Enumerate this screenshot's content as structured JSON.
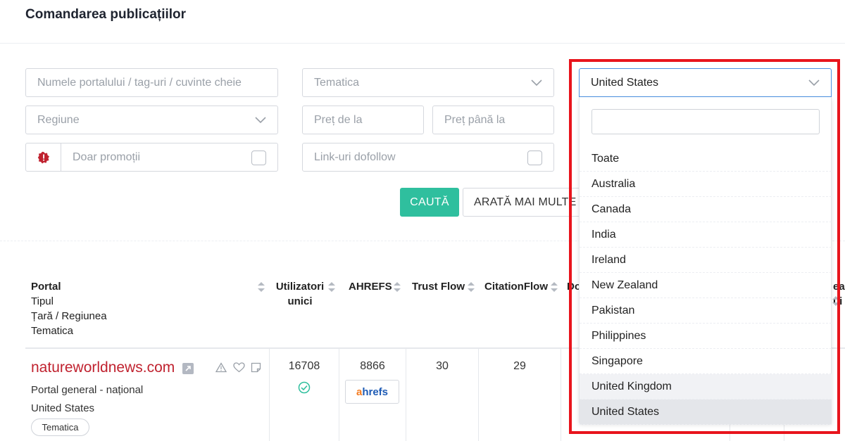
{
  "page": {
    "title": "Comandarea publicațiilor"
  },
  "filters": {
    "keywords_placeholder": "Numele portalului / tag-uri / cuvinte cheie",
    "topic_placeholder": "Tematica",
    "country_value": "United States",
    "region_placeholder": "Regiune",
    "price_from_placeholder": "Preț de la",
    "price_to_placeholder": "Preț până la",
    "promo_label": "Doar promoții",
    "dofollow_label": "Link-uri dofollow",
    "search_button": "CAUTĂ",
    "more_filters_button": "ARATĂ MAI MULTE F"
  },
  "country_dropdown": {
    "search_value": "",
    "options": [
      "Toate",
      "Australia",
      "Canada",
      "India",
      "Ireland",
      "New Zealand",
      "Pakistan",
      "Philippines",
      "Singapore",
      "United Kingdom",
      "United States"
    ],
    "hovered": "United Kingdom",
    "selected": "United States"
  },
  "table": {
    "headers": {
      "portal": "Portal",
      "portal_sub1": "Tipul",
      "portal_sub2": "Țară / Regiunea",
      "portal_sub3": "Tematica",
      "users_1": "Utilizatori",
      "users_2": "unici",
      "ahrefs": "AHREFS",
      "trust_flow": "Trust Flow",
      "citation_flow": "CitationFlow",
      "do_partial": "Do",
      "right_partial_1": "ea",
      "right_partial_2": "ui"
    },
    "rows": [
      {
        "site": "natureworldnews.com",
        "type": "Portal general - național",
        "country": "United States",
        "tag": "Tematica",
        "unique_users": "16708",
        "ahrefs": "8866",
        "ahrefs_badge_a": "a",
        "ahrefs_badge_rest": "hrefs",
        "trust_flow": "30",
        "citation_flow": "29"
      }
    ]
  },
  "colors": {
    "accent": "#2fbf9e",
    "link": "#c0222f",
    "highlight": "#e8141c",
    "focus": "#4a90e2"
  }
}
